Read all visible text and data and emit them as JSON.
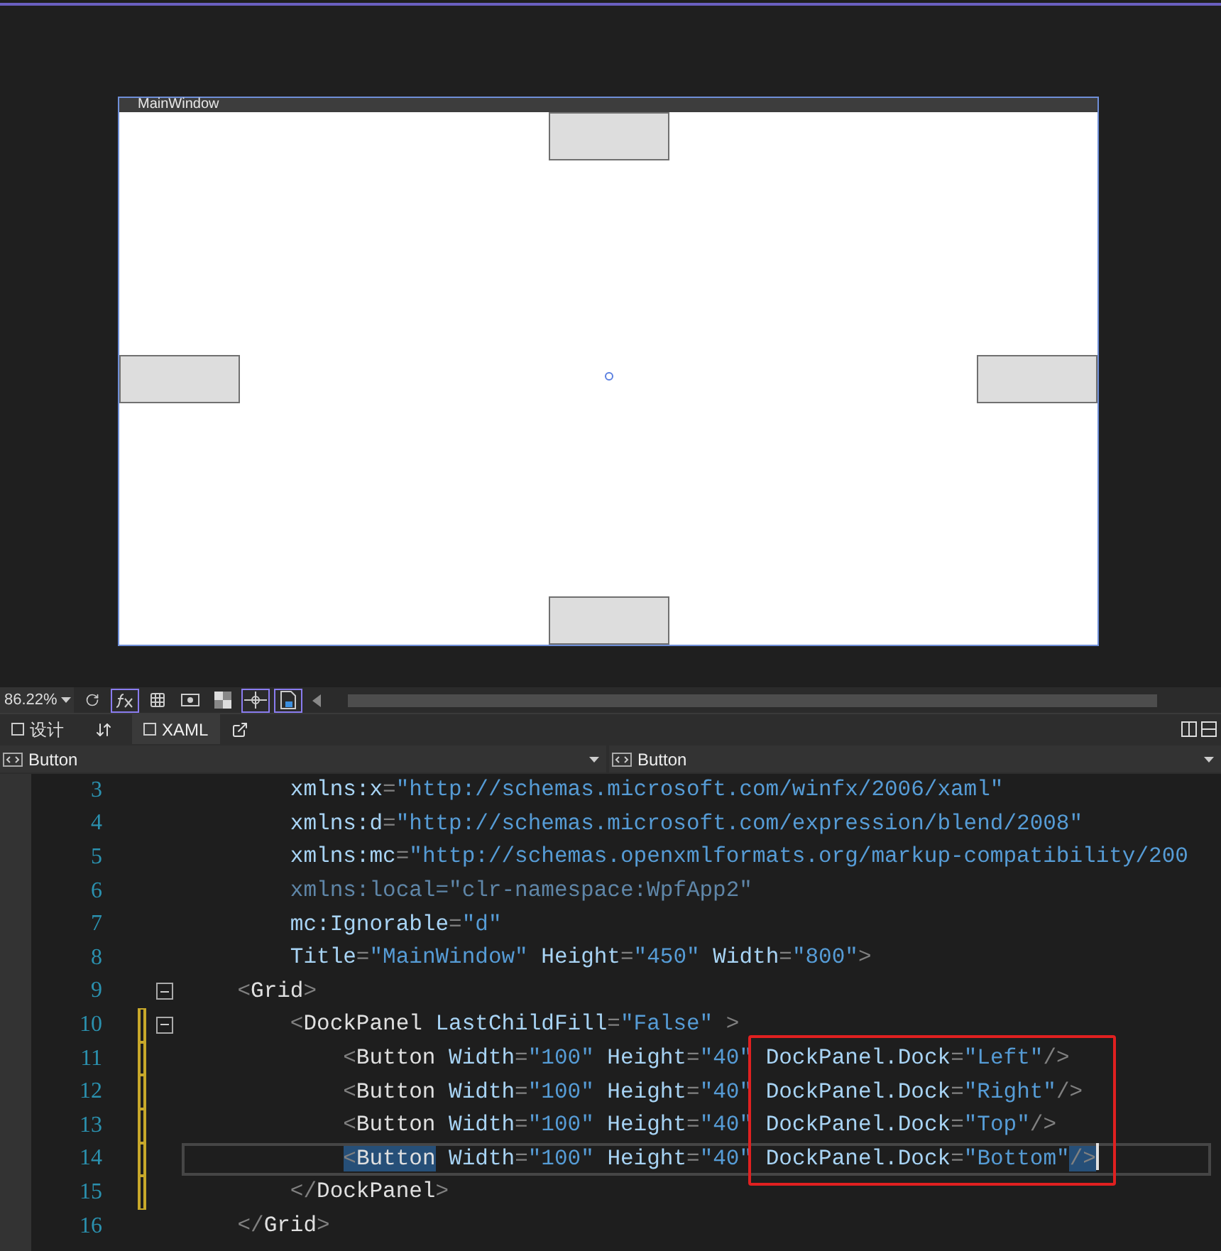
{
  "designer": {
    "window_title": "MainWindow",
    "buttons": [
      {
        "kind": "top"
      },
      {
        "kind": "left"
      },
      {
        "kind": "right"
      },
      {
        "kind": "bottom"
      }
    ]
  },
  "toolbar": {
    "zoom": "86.22%",
    "tools": [
      {
        "kind": "refresh",
        "on": false
      },
      {
        "kind": "fx",
        "on": true
      },
      {
        "kind": "grid",
        "on": false
      },
      {
        "kind": "snap-grid",
        "on": false
      },
      {
        "kind": "checker",
        "on": false
      },
      {
        "kind": "snap-lines",
        "on": true
      },
      {
        "kind": "code-doc",
        "on": true
      }
    ]
  },
  "tabs": [
    {
      "label": "设计",
      "selected": false
    },
    {
      "label": "XAML",
      "selected": true
    }
  ],
  "dropdowns": [
    {
      "value": "Button"
    },
    {
      "value": "Button"
    }
  ],
  "code": {
    "lines": [
      {
        "number": "3",
        "changed": false,
        "current": false,
        "segments": [
          {
            "text": "        xmlns:x",
            "kind": "attr"
          },
          {
            "text": "=",
            "kind": "punct"
          },
          {
            "text": "\"http://schemas.microsoft.com/winfx/2006/xaml\"",
            "kind": "value"
          }
        ]
      },
      {
        "number": "4",
        "changed": false,
        "current": false,
        "segments": [
          {
            "text": "        xmlns:d",
            "kind": "attr"
          },
          {
            "text": "=",
            "kind": "punct"
          },
          {
            "text": "\"http://schemas.microsoft.com/expression/blend/2008\"",
            "kind": "value"
          }
        ]
      },
      {
        "number": "5",
        "changed": false,
        "current": false,
        "segments": [
          {
            "text": "        xmlns:mc",
            "kind": "attr"
          },
          {
            "text": "=",
            "kind": "punct"
          },
          {
            "text": "\"http://schemas.openxmlformats.org/markup-compatibility/200",
            "kind": "value"
          }
        ]
      },
      {
        "number": "6",
        "changed": false,
        "current": false,
        "segments": [
          {
            "text": "        xmlns:local=\"clr-namespace:WpfApp2\"",
            "kind": "dim"
          }
        ]
      },
      {
        "number": "7",
        "changed": false,
        "current": false,
        "segments": [
          {
            "text": "        mc:Ignorable",
            "kind": "attr"
          },
          {
            "text": "=",
            "kind": "punct"
          },
          {
            "text": "\"d\"",
            "kind": "value"
          }
        ]
      },
      {
        "number": "8",
        "changed": false,
        "current": false,
        "segments": [
          {
            "text": "        Title",
            "kind": "attr"
          },
          {
            "text": "=",
            "kind": "punct"
          },
          {
            "text": "\"MainWindow\"",
            "kind": "value"
          },
          {
            "text": " Height",
            "kind": "attr"
          },
          {
            "text": "=",
            "kind": "punct"
          },
          {
            "text": "\"450\"",
            "kind": "value"
          },
          {
            "text": " Width",
            "kind": "attr"
          },
          {
            "text": "=",
            "kind": "punct"
          },
          {
            "text": "\"800\"",
            "kind": "value"
          },
          {
            "text": ">",
            "kind": "punct"
          }
        ]
      },
      {
        "number": "9",
        "changed": false,
        "current": false,
        "expanded": true,
        "segments": [
          {
            "text": "    <",
            "kind": "punct"
          },
          {
            "text": "Grid",
            "kind": "element"
          },
          {
            "text": ">",
            "kind": "punct"
          }
        ]
      },
      {
        "number": "10",
        "changed": true,
        "current": false,
        "expanded": true,
        "segments": [
          {
            "text": "        <",
            "kind": "punct"
          },
          {
            "text": "DockPanel",
            "kind": "element"
          },
          {
            "text": " LastChildFill",
            "kind": "attr"
          },
          {
            "text": "=",
            "kind": "punct"
          },
          {
            "text": "\"False\"",
            "kind": "value"
          },
          {
            "text": " >",
            "kind": "punct"
          }
        ]
      },
      {
        "number": "11",
        "changed": true,
        "current": false,
        "segments": [
          {
            "text": "            <",
            "kind": "punct"
          },
          {
            "text": "Button",
            "kind": "element"
          },
          {
            "text": " Width",
            "kind": "attr"
          },
          {
            "text": "=",
            "kind": "punct"
          },
          {
            "text": "\"100\"",
            "kind": "value"
          },
          {
            "text": " Height",
            "kind": "attr"
          },
          {
            "text": "=",
            "kind": "punct"
          },
          {
            "text": "\"40\"",
            "kind": "value"
          },
          {
            "text": " DockPanel.Dock",
            "kind": "attr"
          },
          {
            "text": "=",
            "kind": "punct"
          },
          {
            "text": "\"Left\"",
            "kind": "value"
          },
          {
            "text": "/>",
            "kind": "punct"
          }
        ]
      },
      {
        "number": "12",
        "changed": true,
        "current": false,
        "segments": [
          {
            "text": "            <",
            "kind": "punct"
          },
          {
            "text": "Button",
            "kind": "element"
          },
          {
            "text": " Width",
            "kind": "attr"
          },
          {
            "text": "=",
            "kind": "punct"
          },
          {
            "text": "\"100\"",
            "kind": "value"
          },
          {
            "text": " Height",
            "kind": "attr"
          },
          {
            "text": "=",
            "kind": "punct"
          },
          {
            "text": "\"40\"",
            "kind": "value"
          },
          {
            "text": " DockPanel.Dock",
            "kind": "attr"
          },
          {
            "text": "=",
            "kind": "punct"
          },
          {
            "text": "\"Right\"",
            "kind": "value"
          },
          {
            "text": "/>",
            "kind": "punct"
          }
        ]
      },
      {
        "number": "13",
        "changed": true,
        "current": false,
        "segments": [
          {
            "text": "            <",
            "kind": "punct"
          },
          {
            "text": "Button",
            "kind": "element"
          },
          {
            "text": " Width",
            "kind": "attr"
          },
          {
            "text": "=",
            "kind": "punct"
          },
          {
            "text": "\"100\"",
            "kind": "value"
          },
          {
            "text": " Height",
            "kind": "attr"
          },
          {
            "text": "=",
            "kind": "punct"
          },
          {
            "text": "\"40\"",
            "kind": "value"
          },
          {
            "text": " DockPanel.Dock",
            "kind": "attr"
          },
          {
            "text": "=",
            "kind": "punct"
          },
          {
            "text": "\"Top\"",
            "kind": "value"
          },
          {
            "text": "/>",
            "kind": "punct"
          }
        ]
      },
      {
        "number": "14",
        "changed": true,
        "current": true,
        "segments": [
          {
            "text": "            <",
            "kind": "punct",
            "selected": true
          },
          {
            "text": "Button",
            "kind": "element",
            "selected": true
          },
          {
            "text": " Width",
            "kind": "attr",
            "selected": false
          },
          {
            "text": "=",
            "kind": "punct",
            "selected": false
          },
          {
            "text": "\"100\"",
            "kind": "value",
            "selected": false
          },
          {
            "text": " Height",
            "kind": "attr",
            "selected": false
          },
          {
            "text": "=",
            "kind": "punct",
            "selected": false
          },
          {
            "text": "\"40\"",
            "kind": "value",
            "selected": false
          },
          {
            "text": " DockPanel.Dock",
            "kind": "attr",
            "selected": false
          },
          {
            "text": "=",
            "kind": "punct",
            "selected": false
          },
          {
            "text": "\"Bottom\"",
            "kind": "value",
            "selected": false
          },
          {
            "text": "/>",
            "kind": "punct",
            "selected": true
          }
        ]
      },
      {
        "number": "15",
        "changed": true,
        "current": false,
        "segments": [
          {
            "text": "        </",
            "kind": "punct"
          },
          {
            "text": "DockPanel",
            "kind": "element"
          },
          {
            "text": ">",
            "kind": "punct"
          }
        ]
      },
      {
        "number": "16",
        "changed": false,
        "current": false,
        "segments": [
          {
            "text": "    </",
            "kind": "punct"
          },
          {
            "text": "Grid",
            "kind": "element"
          },
          {
            "text": ">",
            "kind": "punct"
          }
        ]
      }
    ]
  }
}
